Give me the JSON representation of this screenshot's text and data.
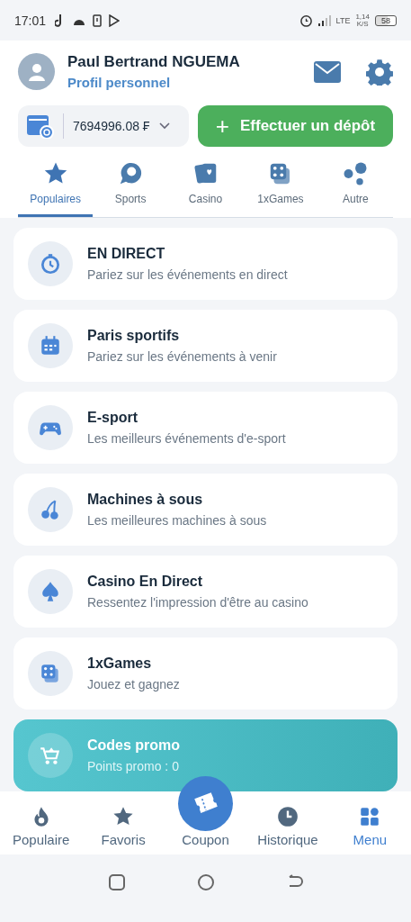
{
  "status_bar": {
    "time": "17:01",
    "network": "LTE",
    "speed": "1,14",
    "speed_unit": "K/S",
    "battery": "58"
  },
  "profile": {
    "name": "Paul Bertrand NGUEMA",
    "subtitle": "Profil personnel"
  },
  "balance": {
    "amount": "7694996.08 ₣"
  },
  "deposit_button": {
    "label": "Effectuer un dépôt",
    "icon": "+"
  },
  "tabs": [
    {
      "label": "Populaires",
      "kind": "star",
      "selected": true
    },
    {
      "label": "Sports",
      "kind": "ball",
      "selected": false
    },
    {
      "label": "Casino",
      "kind": "cards",
      "selected": false
    },
    {
      "label": "1xGames",
      "kind": "dice",
      "selected": false
    },
    {
      "label": "Autre",
      "kind": "dots",
      "selected": false
    }
  ],
  "menu_items": [
    {
      "title": "EN DIRECT",
      "subtitle": "Pariez sur les événements en direct",
      "kind": "stopwatch"
    },
    {
      "title": "Paris sportifs",
      "subtitle": "Pariez sur les événements à venir",
      "kind": "calendar"
    },
    {
      "title": "E-sport",
      "subtitle": "Les meilleurs événements d'e-sport",
      "kind": "gamepad"
    },
    {
      "title": "Machines à sous",
      "subtitle": "Les meilleures machines à sous",
      "kind": "cherry"
    },
    {
      "title": "Casino En Direct",
      "subtitle": "Ressentez l'impression d'être au casino",
      "kind": "spade"
    },
    {
      "title": "1xGames",
      "subtitle": "Jouez et gagnez",
      "kind": "dice"
    },
    {
      "title": "Codes promo",
      "subtitle": "Points promo : 0",
      "kind": "cart"
    }
  ],
  "bottom_nav": [
    {
      "label": "Populaire",
      "kind": "flame",
      "selected": false
    },
    {
      "label": "Favoris",
      "kind": "star",
      "selected": false
    },
    {
      "label": "Coupon",
      "kind": "ticket",
      "selected": false
    },
    {
      "label": "Historique",
      "kind": "clock",
      "selected": false
    },
    {
      "label": "Menu",
      "kind": "grid",
      "selected": true
    }
  ]
}
